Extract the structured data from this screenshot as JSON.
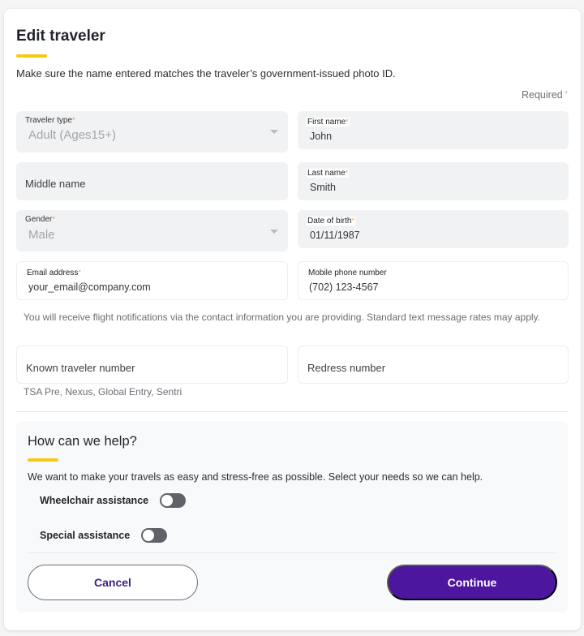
{
  "header": {
    "title": "Edit traveler",
    "subtitle": "Make sure the name entered matches the traveler’s government-issued photo ID.",
    "required_label": "Required",
    "required_mark": "*"
  },
  "fields": {
    "traveler_type": {
      "label": "Traveler type",
      "value": "Adult (Ages15+)",
      "required": "*"
    },
    "first_name": {
      "label": "First name",
      "value": "John",
      "required": "*"
    },
    "middle_name": {
      "placeholder": "Middle name"
    },
    "last_name": {
      "label": "Last name",
      "value": "Smith",
      "required": "*"
    },
    "gender": {
      "label": "Gender",
      "value": "Male",
      "required": "*"
    },
    "date_of_birth": {
      "label": "Date of birth",
      "value": "01/11/1987",
      "required": "*"
    },
    "email": {
      "label": "Email address",
      "value": "your_email@company.com",
      "required": "*"
    },
    "mobile_phone": {
      "label": "Mobile phone number",
      "value": "(702) 123-4567"
    },
    "known_traveler": {
      "placeholder": "Known traveler number",
      "hint": "TSA Pre, Nexus, Global Entry, Sentri"
    },
    "redress": {
      "placeholder": "Redress number"
    }
  },
  "contact_note": "You will receive flight notifications via the contact information you are providing. Standard text message rates may apply.",
  "help": {
    "title": "How can we help?",
    "text": "We want to make your travels as easy and stress-free as possible. Select your needs so we can help.",
    "toggles": [
      {
        "label": "Wheelchair assistance",
        "on": false
      },
      {
        "label": "Special assistance",
        "on": false
      }
    ]
  },
  "actions": {
    "cancel_label": "Cancel",
    "continue_label": "Continue"
  },
  "colors": {
    "accent": "#f6c915",
    "primary": "#4c169f"
  }
}
